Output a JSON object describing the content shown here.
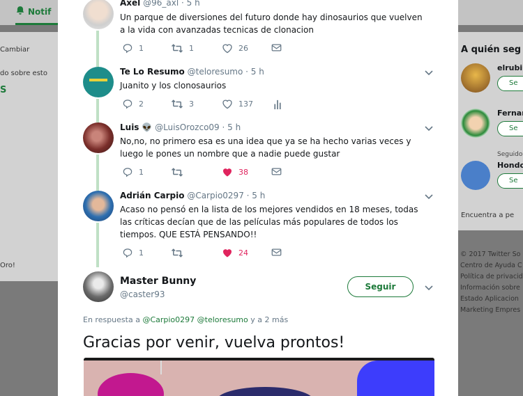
{
  "background": {
    "nav_notifications": "Notif",
    "left_change": "Cambiar",
    "left_about": "do sobre esto",
    "left_s": "S",
    "left_gold": "Oro!",
    "right_title": "A quién seg",
    "right_users": [
      {
        "name": "elrubiu",
        "button": "Se"
      },
      {
        "name": "Fernar",
        "button": "Se"
      },
      {
        "followed": "Seguido",
        "name": "Hondo",
        "button": "Se"
      }
    ],
    "right_find": "Encuentra a pe",
    "footer_lines": [
      "© 2017 Twitter  So",
      "Centro de Ayuda  C",
      "Política de privacid",
      "Información sobre",
      "Estado  Aplicacion",
      "Marketing  Empres"
    ]
  },
  "tweets": [
    {
      "name": "Axel",
      "handle": "@96_axl",
      "time": "· 5 h",
      "text": "Un parque de diversiones del futuro donde hay dinosaurios que vuelven a la vida con avanzadas tecnicas de clonacion",
      "replies": "1",
      "retweets": "1",
      "likes": "26"
    },
    {
      "name": "Te Lo Resumo",
      "handle": "@teloresumo",
      "time": "· 5 h",
      "text": "Juanito y los clonosaurios",
      "replies": "2",
      "retweets": "3",
      "likes": "137"
    },
    {
      "name": "Luis",
      "emoji": "👽",
      "handle": "@LuisOrozco09",
      "time": "· 5 h",
      "text": "No,no, no primero esa es una idea que ya se ha hecho varias veces y luego le pones un nombre que a nadie puede gustar",
      "replies": "1",
      "retweets": "",
      "likes": "38"
    },
    {
      "name": "Adrián Carpio",
      "handle": "@Carpio0297",
      "time": "· 5 h",
      "text": "Acaso no pensó en la lista de los mejores vendidos en 18 meses, todas las críticas decían que de las películas más populares de todos los tiempos. QUE ESTÁ PENSANDO!!",
      "replies": "1",
      "retweets": "",
      "likes": "24"
    }
  ],
  "main": {
    "name": "Master Bunny",
    "handle": "@caster93",
    "follow_label": "Seguir",
    "reply_prefix": "En respuesta a",
    "reply_user1": "@Carpio0297",
    "reply_user2": "@teloresumo",
    "reply_suffix": "y a 2 más",
    "text": "Gracias por venir, vuelva prontos!"
  },
  "colors": {
    "accent": "#1d7a3a",
    "like": "#e0245e",
    "muted": "#657786",
    "thread": "#bfe0c5"
  }
}
